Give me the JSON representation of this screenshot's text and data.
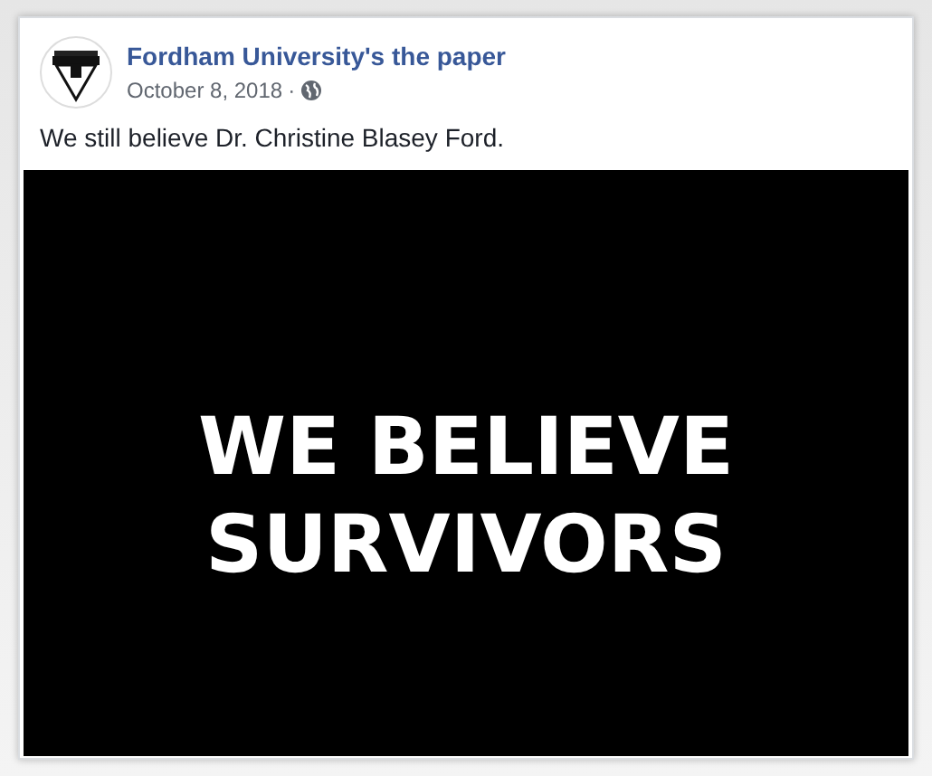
{
  "post": {
    "page_name": "Fordham University's the paper",
    "date": "October 8, 2018",
    "separator": "·",
    "text": "We still believe Dr. Christine Blasey Ford.",
    "image": {
      "lines": [
        "WE BELIEVE",
        "SURVIVORS"
      ]
    }
  }
}
